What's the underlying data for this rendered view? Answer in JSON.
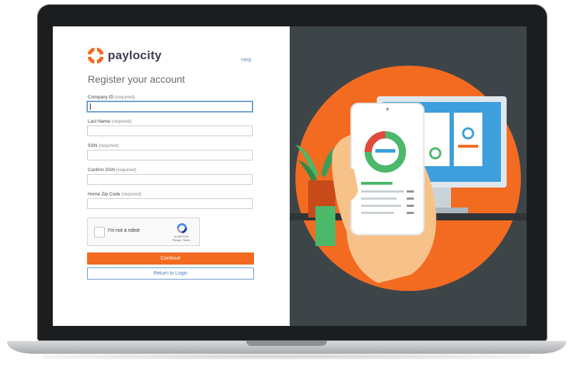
{
  "brand": {
    "name": "paylocity",
    "accent_color": "#f26b21"
  },
  "header": {
    "help_link": "Help"
  },
  "form": {
    "title": "Register your account",
    "fields": [
      {
        "label": "Company ID",
        "required": "(required)",
        "value": ""
      },
      {
        "label": "Last Name",
        "required": "(required)",
        "value": ""
      },
      {
        "label": "SSN",
        "required": "(required)",
        "value": ""
      },
      {
        "label": "Confirm SSN",
        "required": "(required)",
        "value": ""
      },
      {
        "label": "Home Zip Code",
        "required": "(required)",
        "value": ""
      }
    ],
    "captcha": {
      "label": "I'm not a robot",
      "brand": "reCAPTCHA",
      "links": "Privacy - Terms"
    },
    "continue_button": "Continue",
    "return_button": "Return to Login"
  },
  "illustration": {
    "icon": "hand-holding-phone-with-chart-illustration"
  }
}
